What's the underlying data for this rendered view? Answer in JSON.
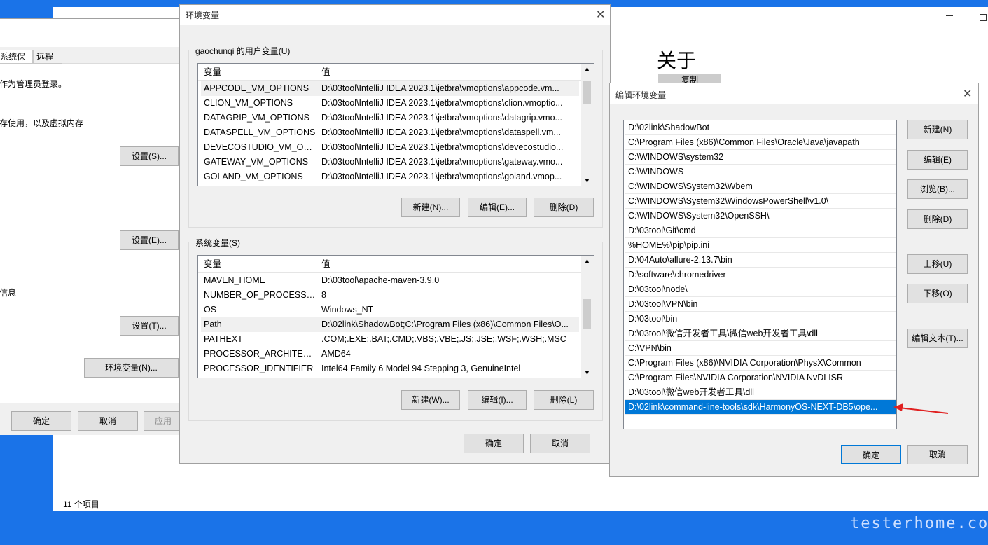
{
  "bg": {
    "status": "11 个项目",
    "title": "关于",
    "copy": "复制"
  },
  "sys": {
    "tabs": [
      "系统保护",
      "远程"
    ],
    "line1": "作为管理员登录。",
    "line2": "存使用，以及虚拟内存",
    "line3": "信息",
    "s1": "设置(S)...",
    "s2": "设置(E)...",
    "s3": "设置(T)...",
    "env": "环境变量(N)...",
    "ok": "确定",
    "cancel": "取消",
    "apply": "应用"
  },
  "env": {
    "title": "环境变量",
    "user_label": "gaochunqi 的用户变量(U)",
    "col1": "变量",
    "col2": "值",
    "user_vars": [
      [
        "APPCODE_VM_OPTIONS",
        "D:\\03tool\\IntelliJ IDEA 2023.1\\jetbra\\vmoptions\\appcode.vm..."
      ],
      [
        "CLION_VM_OPTIONS",
        "D:\\03tool\\IntelliJ IDEA 2023.1\\jetbra\\vmoptions\\clion.vmoptio..."
      ],
      [
        "DATAGRIP_VM_OPTIONS",
        "D:\\03tool\\IntelliJ IDEA 2023.1\\jetbra\\vmoptions\\datagrip.vmo..."
      ],
      [
        "DATASPELL_VM_OPTIONS",
        "D:\\03tool\\IntelliJ IDEA 2023.1\\jetbra\\vmoptions\\dataspell.vm..."
      ],
      [
        "DEVECOSTUDIO_VM_OPT...",
        "D:\\03tool\\IntelliJ IDEA 2023.1\\jetbra\\vmoptions\\devecostudio..."
      ],
      [
        "GATEWAY_VM_OPTIONS",
        "D:\\03tool\\IntelliJ IDEA 2023.1\\jetbra\\vmoptions\\gateway.vmo..."
      ],
      [
        "GOLAND_VM_OPTIONS",
        "D:\\03tool\\IntelliJ IDEA 2023.1\\jetbra\\vmoptions\\goland.vmop..."
      ]
    ],
    "u_new": "新建(N)...",
    "u_edit": "编辑(E)...",
    "u_del": "删除(D)",
    "sys_label": "系统变量(S)",
    "sys_vars": [
      [
        "MAVEN_HOME",
        "D:\\03tool\\apache-maven-3.9.0"
      ],
      [
        "NUMBER_OF_PROCESSORS",
        "8"
      ],
      [
        "OS",
        "Windows_NT"
      ],
      [
        "Path",
        "D:\\02link\\ShadowBot;C:\\Program Files (x86)\\Common Files\\O..."
      ],
      [
        "PATHEXT",
        ".COM;.EXE;.BAT;.CMD;.VBS;.VBE;.JS;.JSE;.WSF;.WSH;.MSC"
      ],
      [
        "PROCESSOR_ARCHITECT...",
        "AMD64"
      ],
      [
        "PROCESSOR_IDENTIFIER",
        "Intel64 Family 6 Model 94 Stepping 3, GenuineIntel"
      ]
    ],
    "s_new": "新建(W)...",
    "s_edit": "编辑(I)...",
    "s_del": "删除(L)",
    "ok": "确定",
    "cancel": "取消"
  },
  "edit": {
    "title": "编辑环境变量",
    "entries": [
      "D:\\02link\\ShadowBot",
      "C:\\Program Files (x86)\\Common Files\\Oracle\\Java\\javapath",
      "C:\\WINDOWS\\system32",
      "C:\\WINDOWS",
      "C:\\WINDOWS\\System32\\Wbem",
      "C:\\WINDOWS\\System32\\WindowsPowerShell\\v1.0\\",
      "C:\\WINDOWS\\System32\\OpenSSH\\",
      "D:\\03tool\\Git\\cmd",
      "%HOME%\\pip\\pip.ini",
      "D:\\04Auto\\allure-2.13.7\\bin",
      "D:\\software\\chromedriver",
      "D:\\03tool\\node\\",
      "D:\\03tool\\VPN\\bin",
      "D:\\03tool\\bin",
      "D:\\03tool\\微信开发者工具\\微信web开发者工具\\dll",
      "C:\\VPN\\bin",
      "C:\\Program Files (x86)\\NVIDIA Corporation\\PhysX\\Common",
      "C:\\Program Files\\NVIDIA Corporation\\NVIDIA NvDLISR",
      "D:\\03tool\\微信web开发者工具\\dll",
      "D:\\02link\\command-line-tools\\sdk\\HarmonyOS-NEXT-DB5\\ope..."
    ],
    "new": "新建(N)",
    "edit": "编辑(E)",
    "browse": "浏览(B)...",
    "del": "删除(D)",
    "up": "上移(U)",
    "down": "下移(O)",
    "text": "编辑文本(T)...",
    "ok": "确定",
    "cancel": "取消"
  },
  "watermark": "testerhome.com"
}
